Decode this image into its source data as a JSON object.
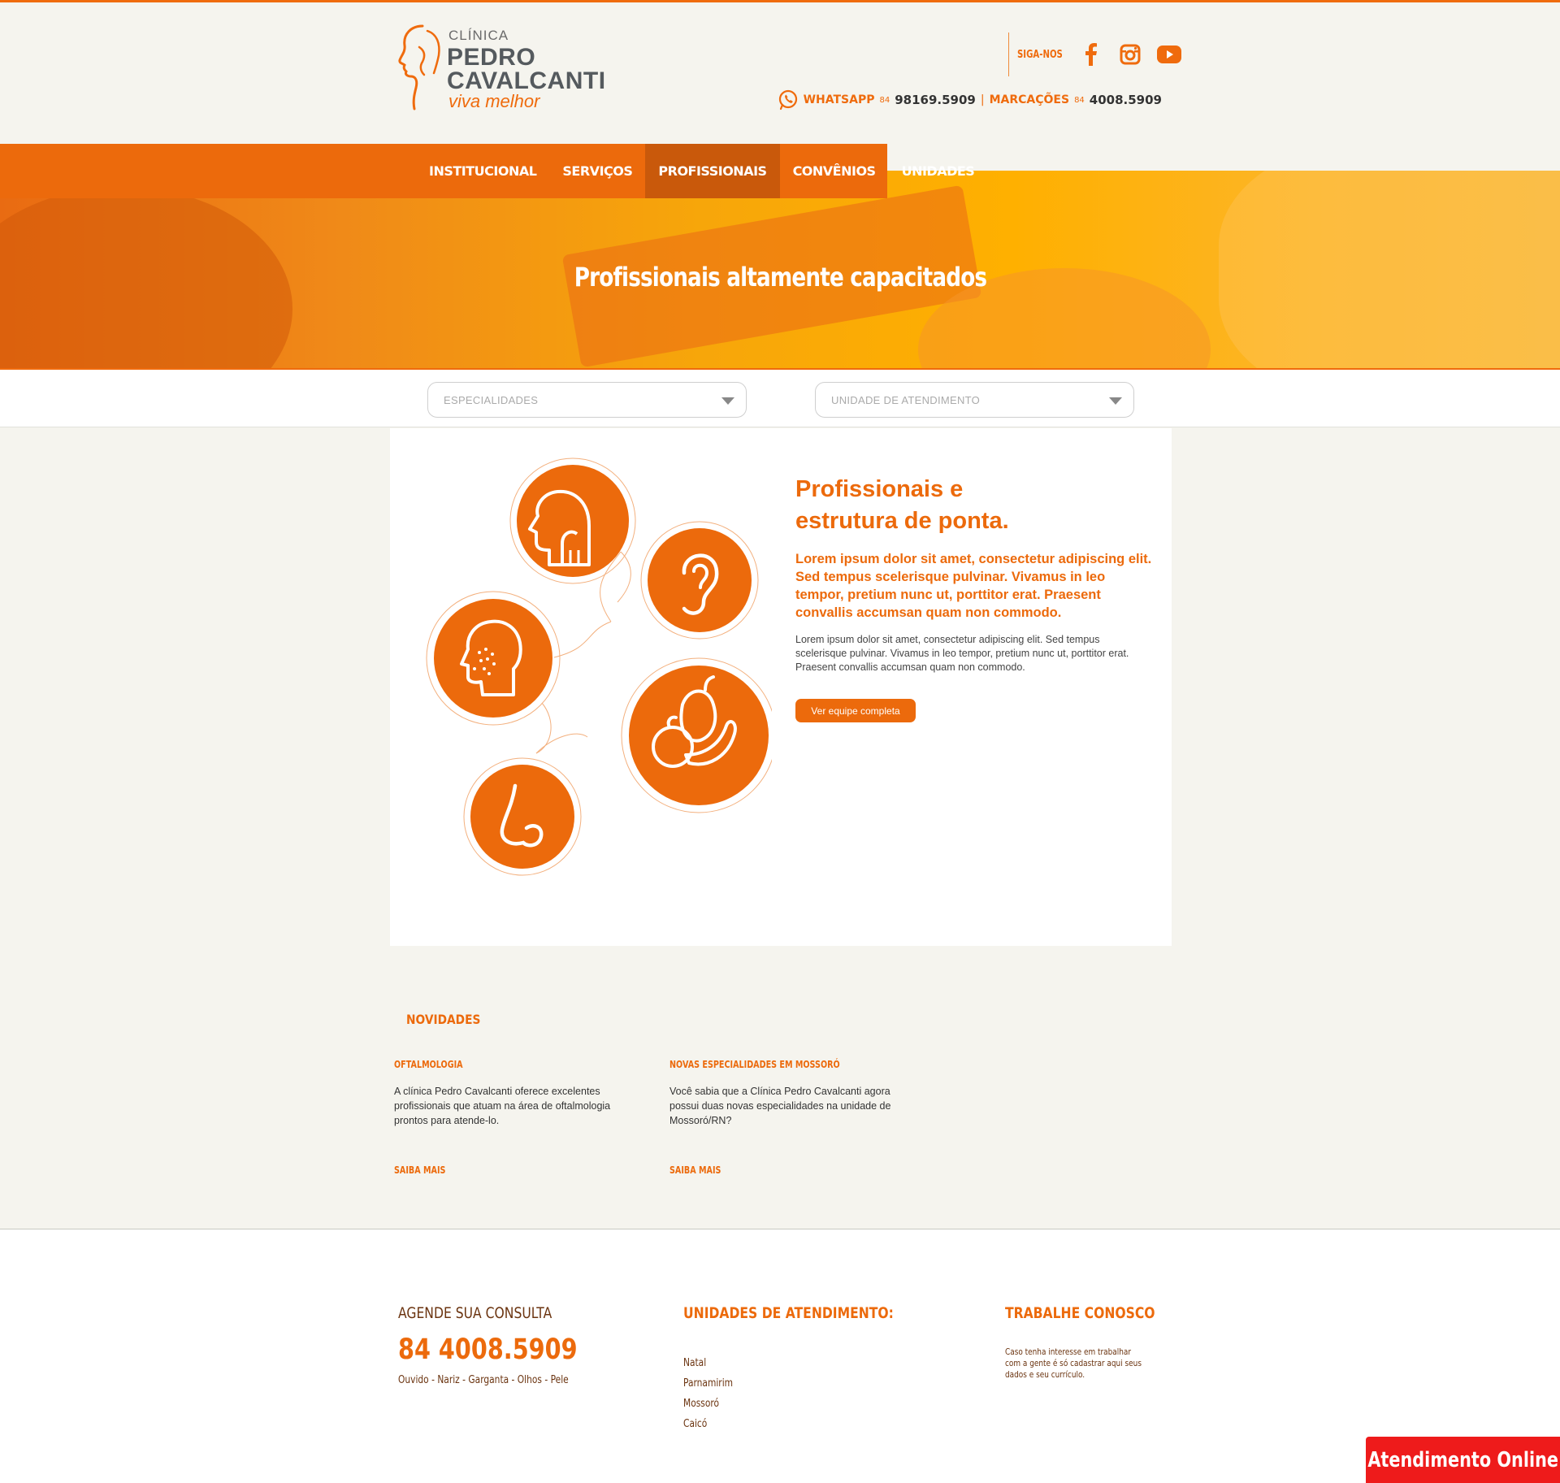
{
  "colors": {
    "brand_orange": "#ec6a0c",
    "nav_active": "#c9590b",
    "background": "#f5f4ee",
    "footer_text": "#6b3410",
    "chat_red": "#ee1b1b"
  },
  "logo": {
    "clinica": "CLÍNICA",
    "name_line1": "PEDRO",
    "name_line2": "CAVALCANTI",
    "slogan": "viva melhor"
  },
  "social": {
    "label": "SIGA-NOS",
    "icons": [
      "facebook-icon",
      "instagram-icon",
      "youtube-icon"
    ]
  },
  "contact": {
    "whatsapp_label": "WHATSAPP",
    "whatsapp_ddd": "84",
    "whatsapp_number": "98169.5909",
    "separator": "|",
    "marcacoes_label": "MARCAÇÕES",
    "marcacoes_ddd": "84",
    "marcacoes_number": "4008.5909"
  },
  "nav": {
    "items": [
      "INSTITUCIONAL",
      "SERVIÇOS",
      "PROFISSIONAIS",
      "CONVÊNIOS",
      "UNIDADES"
    ],
    "active": "PROFISSIONAIS"
  },
  "hero": {
    "title": "Profissionais altamente capacitados"
  },
  "filters": {
    "especialidades": "ESPECIALIDADES",
    "unidade": "UNIDADE DE ATENDIMENTO"
  },
  "feature": {
    "title_line1": "Profissionais e",
    "title_line2": "estrutura de ponta.",
    "lead": "Lorem ipsum dolor sit amet, consectetur adipiscing elit. Sed tempus scelerisque pulvinar. Vivamus in leo tempor, pretium nunc ut, porttitor erat. Praesent convallis accumsan quam non commodo.",
    "body": "Lorem ipsum dolor sit amet, consectetur adipiscing elit. Sed tempus scelerisque pulvinar. Vivamus in leo tempor, pretium nunc ut, porttitor erat. Praesent convallis accumsan quam non commodo.",
    "button": "Ver equipe completa",
    "specialty_icons": [
      "throat-icon",
      "ear-icon",
      "skin-face-icon",
      "nutrition-fruit-icon",
      "nose-icon"
    ]
  },
  "news": {
    "title": "NOVIDADES",
    "items": [
      {
        "title": "OFTALMOLOGIA",
        "text": "A clínica Pedro Cavalcanti oferece excelentes profissionais que atuam na área de oftalmologia prontos para atende-lo.",
        "more": "SAIBA MAIS"
      },
      {
        "title": "NOVAS ESPECIALIDADES EM MOSSORÓ",
        "text": "Você sabia que a Clínica Pedro Cavalcanti agora possui duas novas especialidades na unidade de Mossoró/RN?",
        "more": "SAIBA MAIS"
      }
    ]
  },
  "footer": {
    "agende": {
      "title": "AGENDE SUA CONSULTA",
      "phone": "84 4008.5909",
      "specialties": "Ouvido - Nariz - Garganta - Olhos - Pele"
    },
    "unidades": {
      "title": "UNIDADES DE ATENDIMENTO:",
      "items": [
        "Natal",
        "Parnamirim",
        "Mossoró",
        "Caicó"
      ]
    },
    "trabalhe": {
      "title": "TRABALHE CONOSCO",
      "text": "Caso tenha interesse em trabalhar com a gente é só cadastrar aqui seus dados e seu currículo."
    }
  },
  "chat": {
    "label": "Atendimento Online"
  }
}
